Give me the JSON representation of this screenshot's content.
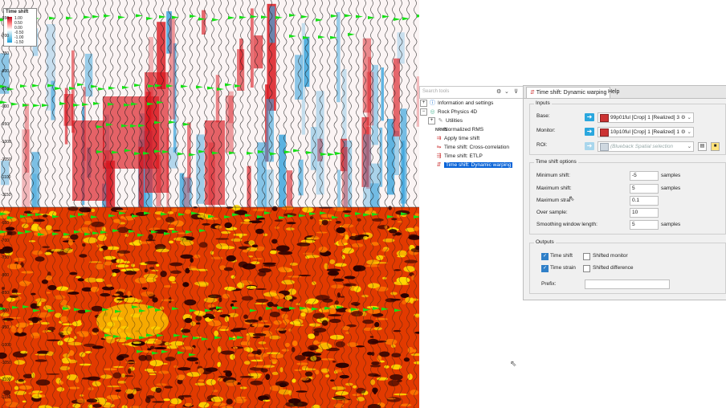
{
  "seismic": {
    "legend_title": "Time shift",
    "legend_ticks": [
      "1.00",
      "0.50",
      "0.00",
      "-0.50",
      "-1.00",
      "-1.50"
    ],
    "top_axis_labels": [
      "-650",
      "-700",
      "-750",
      "-800",
      "-850",
      "-900",
      "-950",
      "-1000",
      "-1050",
      "-1100",
      "-1150"
    ],
    "bottom_axis_labels": [
      "-650",
      "-700",
      "-750",
      "-800",
      "-850",
      "-900",
      "-950",
      "-1000",
      "-1050",
      "-1100",
      "-1150"
    ],
    "colors": {
      "positive": "#d8141c",
      "negative": "#3aa4dc",
      "heat_dark": "#2a0000",
      "heat_mid": "#e23a00",
      "heat_bright": "#ffd800",
      "pick": "#16e016"
    }
  },
  "tools": {
    "search_placeholder": "Search tools",
    "items": [
      {
        "label": "Information and settings",
        "icon": "info-icon",
        "expander": "+",
        "level": 0
      },
      {
        "label": "Rock Physics 4D",
        "icon": "rock-physics-icon",
        "expander": "-",
        "level": 0
      },
      {
        "label": "Utilities",
        "icon": "utilities-icon",
        "expander": "+",
        "level": 1
      },
      {
        "label": "Normalized RMS",
        "icon": "nrms-icon",
        "expander": "",
        "level": 1
      },
      {
        "label": "Apply time shift",
        "icon": "apply-time-shift-icon",
        "expander": "",
        "level": 1
      },
      {
        "label": "Time shift: Cross-correlation",
        "icon": "cross-correlation-icon",
        "expander": "",
        "level": 1
      },
      {
        "label": "Time shift: ETLP",
        "icon": "etlp-icon",
        "expander": "",
        "level": 1
      },
      {
        "label": "Time shift: Dynamic warping",
        "icon": "dynamic-warping-icon",
        "expander": "",
        "level": 1,
        "selected": true
      }
    ]
  },
  "panel": {
    "tab_main": "Time shift: Dynamic warping",
    "tab_help": "Help",
    "inputs": {
      "title": "Inputs",
      "base_label": "Base:",
      "base_value": "99p01ful [Crop] 1 [Realized] 3",
      "monitor_label": "Monitor:",
      "monitor_value": "10p10ful [Crop] 1 [Realized] 1",
      "roi_label": "ROI:",
      "roi_value": "(Blueback Spatial selection"
    },
    "options": {
      "title": "Time shift options",
      "min_shift_label": "Minimum shift:",
      "min_shift_value": "-5",
      "min_shift_unit": "samples",
      "max_shift_label": "Maximum shift:",
      "max_shift_value": "5",
      "max_shift_unit": "samples",
      "max_strain_label": "Maximum strai",
      "max_strain_value": "0.1",
      "over_sample_label": "Over sample:",
      "over_sample_value": "10",
      "smoothing_label": "Smoothing window length:",
      "smoothing_value": "5",
      "smoothing_unit": "samples"
    },
    "outputs": {
      "title": "Outputs",
      "time_shift": "Time shift",
      "time_strain": "Time strain",
      "shifted_monitor": "Shifted monitor",
      "shifted_difference": "Shifted difference",
      "prefix_label": "Prefix:",
      "prefix_value": ""
    }
  }
}
